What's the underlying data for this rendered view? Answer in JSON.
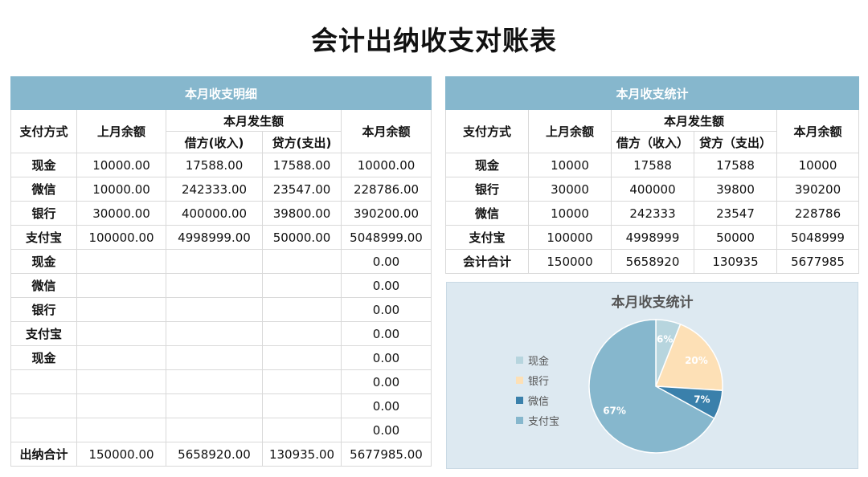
{
  "title": "会计出纳收支对账表",
  "left_table": {
    "header": "本月收支明细",
    "col_payment": "支付方式",
    "col_prev": "上月余额",
    "col_occurred": "本月发生额",
    "col_debit": "借方(收入)",
    "col_credit": "贷方(支出)",
    "col_balance": "本月余额",
    "rows": [
      {
        "method": "现金",
        "prev": "10000.00",
        "debit": "17588.00",
        "credit": "17588.00",
        "balance": "10000.00"
      },
      {
        "method": "微信",
        "prev": "10000.00",
        "debit": "242333.00",
        "credit": "23547.00",
        "balance": "228786.00"
      },
      {
        "method": "银行",
        "prev": "30000.00",
        "debit": "400000.00",
        "credit": "39800.00",
        "balance": "390200.00"
      },
      {
        "method": "支付宝",
        "prev": "100000.00",
        "debit": "4998999.00",
        "credit": "50000.00",
        "balance": "5048999.00"
      },
      {
        "method": "现金",
        "prev": "",
        "debit": "",
        "credit": "",
        "balance": "0.00"
      },
      {
        "method": "微信",
        "prev": "",
        "debit": "",
        "credit": "",
        "balance": "0.00"
      },
      {
        "method": "银行",
        "prev": "",
        "debit": "",
        "credit": "",
        "balance": "0.00"
      },
      {
        "method": "支付宝",
        "prev": "",
        "debit": "",
        "credit": "",
        "balance": "0.00"
      },
      {
        "method": "现金",
        "prev": "",
        "debit": "",
        "credit": "",
        "balance": "0.00"
      },
      {
        "method": "",
        "prev": "",
        "debit": "",
        "credit": "",
        "balance": "0.00"
      },
      {
        "method": "",
        "prev": "",
        "debit": "",
        "credit": "",
        "balance": "0.00"
      },
      {
        "method": "",
        "prev": "",
        "debit": "",
        "credit": "",
        "balance": "0.00"
      }
    ],
    "total": {
      "method": "出纳合计",
      "prev": "150000.00",
      "debit": "5658920.00",
      "credit": "130935.00",
      "balance": "5677985.00"
    }
  },
  "right_table": {
    "header": "本月收支统计",
    "col_payment": "支付方式",
    "col_prev": "上月余额",
    "col_occurred": "本月发生额",
    "col_debit": "借方（收入）",
    "col_credit": "贷方（支出）",
    "col_balance": "本月余额",
    "rows": [
      {
        "method": "现金",
        "prev": "10000",
        "debit": "17588",
        "credit": "17588",
        "balance": "10000"
      },
      {
        "method": "银行",
        "prev": "30000",
        "debit": "400000",
        "credit": "39800",
        "balance": "390200"
      },
      {
        "method": "微信",
        "prev": "10000",
        "debit": "242333",
        "credit": "23547",
        "balance": "228786"
      },
      {
        "method": "支付宝",
        "prev": "100000",
        "debit": "4998999",
        "credit": "50000",
        "balance": "5048999"
      }
    ],
    "total": {
      "method": "会计合计",
      "prev": "150000",
      "debit": "5658920",
      "credit": "130935",
      "balance": "5677985"
    }
  },
  "chart_data": {
    "type": "pie",
    "title": "本月收支统计",
    "categories": [
      "现金",
      "银行",
      "微信",
      "支付宝"
    ],
    "values": [
      6,
      20,
      7,
      67
    ],
    "labels": [
      "6%",
      "20%",
      "7%",
      "67%"
    ],
    "colors": [
      "#b7d5de",
      "#fde0b6",
      "#3a80ab",
      "#86b7cd"
    ],
    "legend_position": "left"
  }
}
